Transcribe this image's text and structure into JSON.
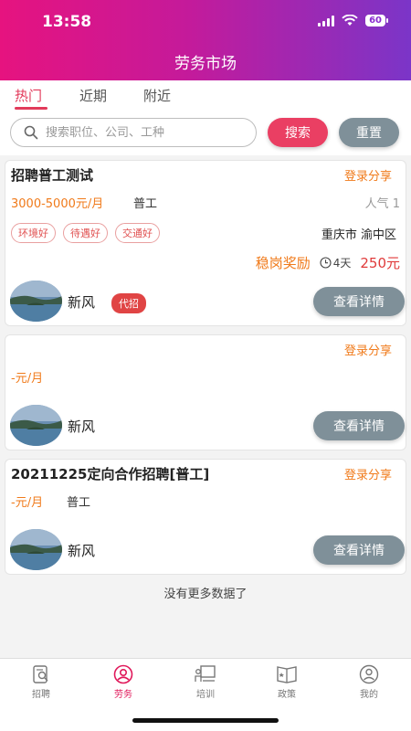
{
  "status_bar": {
    "time": "13:58",
    "battery": "60"
  },
  "header": {
    "title": "劳务市场"
  },
  "tabs": [
    {
      "label": "热门",
      "active": true
    },
    {
      "label": "近期",
      "active": false
    },
    {
      "label": "附近",
      "active": false
    }
  ],
  "search": {
    "placeholder": "搜索职位、公司、工种",
    "value": "",
    "search_label": "搜索",
    "reset_label": "重置"
  },
  "jobs": [
    {
      "title": "招聘普工测试",
      "share": "登录分享",
      "salary": "3000-5000元/月",
      "job_type": "普工",
      "popularity": "人气 1",
      "tags": [
        "环境好",
        "待遇好",
        "交通好"
      ],
      "location": "重庆市 渝中区",
      "bonus_label": "稳岗奖励",
      "days": "4天",
      "bonus_amount": "250元",
      "company": "新风",
      "badge": "代招",
      "detail_label": "查看详情"
    },
    {
      "title": "",
      "share": "登录分享",
      "salary": "-元/月",
      "job_type": "",
      "company": "新风",
      "detail_label": "查看详情"
    },
    {
      "title": "20211225定向合作招聘[普工]",
      "share": "登录分享",
      "salary": "-元/月",
      "job_type": "普工",
      "company": "新风",
      "detail_label": "查看详情"
    }
  ],
  "footer_text": "没有更多数据了",
  "bottom_nav": [
    {
      "label": "招聘",
      "icon": "recruit-icon",
      "active": false
    },
    {
      "label": "劳务",
      "icon": "labor-icon",
      "active": true
    },
    {
      "label": "培训",
      "icon": "training-icon",
      "active": false
    },
    {
      "label": "政策",
      "icon": "policy-icon",
      "active": false
    },
    {
      "label": "我的",
      "icon": "profile-icon",
      "active": false
    }
  ],
  "colors": {
    "brand_pink": "#e6137f",
    "brand_purple": "#7b35c8",
    "accent_orange": "#f07a1a",
    "accent_red": "#ea3f63",
    "button_gray": "#7f9099"
  }
}
